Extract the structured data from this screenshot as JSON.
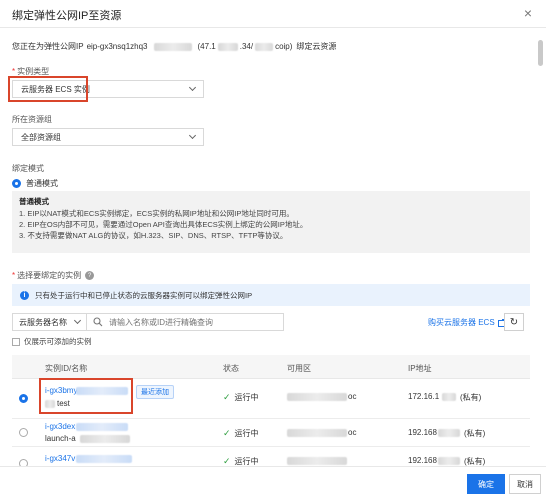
{
  "dialog": {
    "title": "绑定弹性公网IP至资源",
    "close": "×"
  },
  "intro": {
    "prefix": "您正在为弹性公网IP",
    "eip_id": "eip-gx3nsq1zhq3",
    "ip_part": "(47.1",
    "ip_part2": ".34/",
    "ip_suffix": "coip)",
    "suffix": "绑定云资源"
  },
  "instance_type": {
    "label": "实例类型",
    "value": "云服务器 ECS 实例"
  },
  "resource_group": {
    "label": "所在资源组",
    "value": "全部资源组"
  },
  "bind_mode": {
    "label": "绑定模式",
    "option": "普通模式"
  },
  "note": {
    "title": "普通模式",
    "lines": [
      "1. EIP以NAT模式和ECS实例绑定，ECS实例的私网IP地址和公网IP地址同时可用。",
      "2. EIP在OS内部不可见，需要通过Open API查询出具体ECS实例上绑定的公网IP地址。",
      "3. 不支持需要做NAT ALG的协议，如H.323、SIP、DNS、RTSP、TFTP等协议。"
    ]
  },
  "select_instance": {
    "label": "选择要绑定的实例",
    "help": "?"
  },
  "info": {
    "text": "只有处于运行中和已停止状态的云服务器实例可以绑定弹性公网IP"
  },
  "search": {
    "filter": "云服务器名称",
    "placeholder": "请输入名称或ID进行精确查询",
    "buy_link": "购买云服务器 ECS",
    "checkbox_label": "仅展示可添加的实例"
  },
  "table": {
    "headers": {
      "id": "实例ID/名称",
      "status": "状态",
      "zone": "可用区",
      "ip": "IP地址"
    },
    "rows": [
      {
        "id": "i-gx3bmy",
        "name": "test",
        "tag": "最近添加",
        "status": "运行中",
        "zone": "oc",
        "ip": "172.16.1",
        "ip_type": "(私有)",
        "selected": true
      },
      {
        "id": "i-gx3dex",
        "name": "launch-a",
        "tag": "",
        "status": "运行中",
        "zone": "oc",
        "ip": "192.168",
        "ip_type": "(私有)",
        "selected": false
      },
      {
        "id": "i-gx347v",
        "name": "",
        "tag": "",
        "status": "运行中",
        "zone": "",
        "ip": "192.168",
        "ip_type": "(私有)",
        "selected": false
      }
    ]
  },
  "footer": {
    "confirm": "确定",
    "cancel": "取消"
  }
}
